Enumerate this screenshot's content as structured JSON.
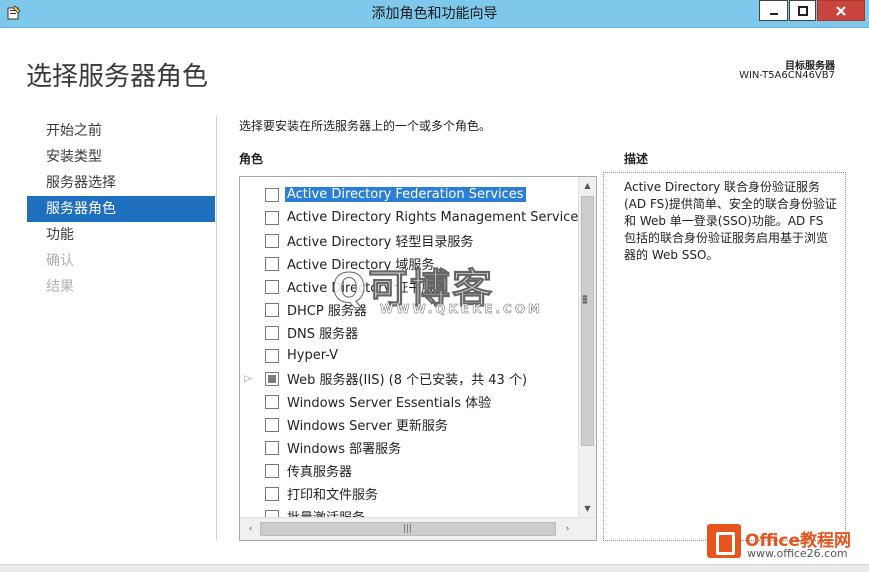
{
  "window": {
    "title": "添加角色和功能向导"
  },
  "header": {
    "page_title": "选择服务器角色",
    "target_label": "目标服务器",
    "target_name": "WIN-T5A6CN46VB7"
  },
  "nav": {
    "items": [
      {
        "label": "开始之前",
        "state": "normal"
      },
      {
        "label": "安装类型",
        "state": "normal"
      },
      {
        "label": "服务器选择",
        "state": "normal"
      },
      {
        "label": "服务器角色",
        "state": "active"
      },
      {
        "label": "功能",
        "state": "normal"
      },
      {
        "label": "确认",
        "state": "disabled"
      },
      {
        "label": "结果",
        "state": "disabled"
      }
    ]
  },
  "main": {
    "instruction": "选择要安装在所选服务器上的一个或多个角色。",
    "roles_header": "角色",
    "description_header": "描述",
    "description": "Active Directory 联合身份验证服务(AD FS)提供简单、安全的联合身份验证和 Web 单一登录(SSO)功能。AD FS 包括的联合身份验证服务启用基于浏览器的 Web SSO。",
    "roles": [
      {
        "label": "Active Directory Federation Services",
        "checked": false,
        "selected": true
      },
      {
        "label": "Active Directory Rights Management Services",
        "checked": false
      },
      {
        "label": "Active Directory 轻型目录服务",
        "checked": false
      },
      {
        "label": "Active Directory 域服务",
        "checked": false
      },
      {
        "label": "Active Directory 证书服务",
        "checked": false
      },
      {
        "label": "DHCP 服务器",
        "checked": false
      },
      {
        "label": "DNS 服务器",
        "checked": false
      },
      {
        "label": "Hyper-V",
        "checked": false
      },
      {
        "label": "Web 服务器(IIS) (8 个已安装，共 43 个)",
        "checked": "partial",
        "expandable": true
      },
      {
        "label": "Windows Server Essentials 体验",
        "checked": false
      },
      {
        "label": "Windows Server 更新服务",
        "checked": false
      },
      {
        "label": "Windows 部署服务",
        "checked": false
      },
      {
        "label": "传真服务器",
        "checked": false
      },
      {
        "label": "打印和文件服务",
        "checked": false
      },
      {
        "label": "批量激活服务",
        "checked": false
      }
    ]
  },
  "watermarks": {
    "main": "Q可博客",
    "sub": "WWW.QKEKE.COM",
    "brand": "Office教程网",
    "url": "www.office26.com"
  }
}
